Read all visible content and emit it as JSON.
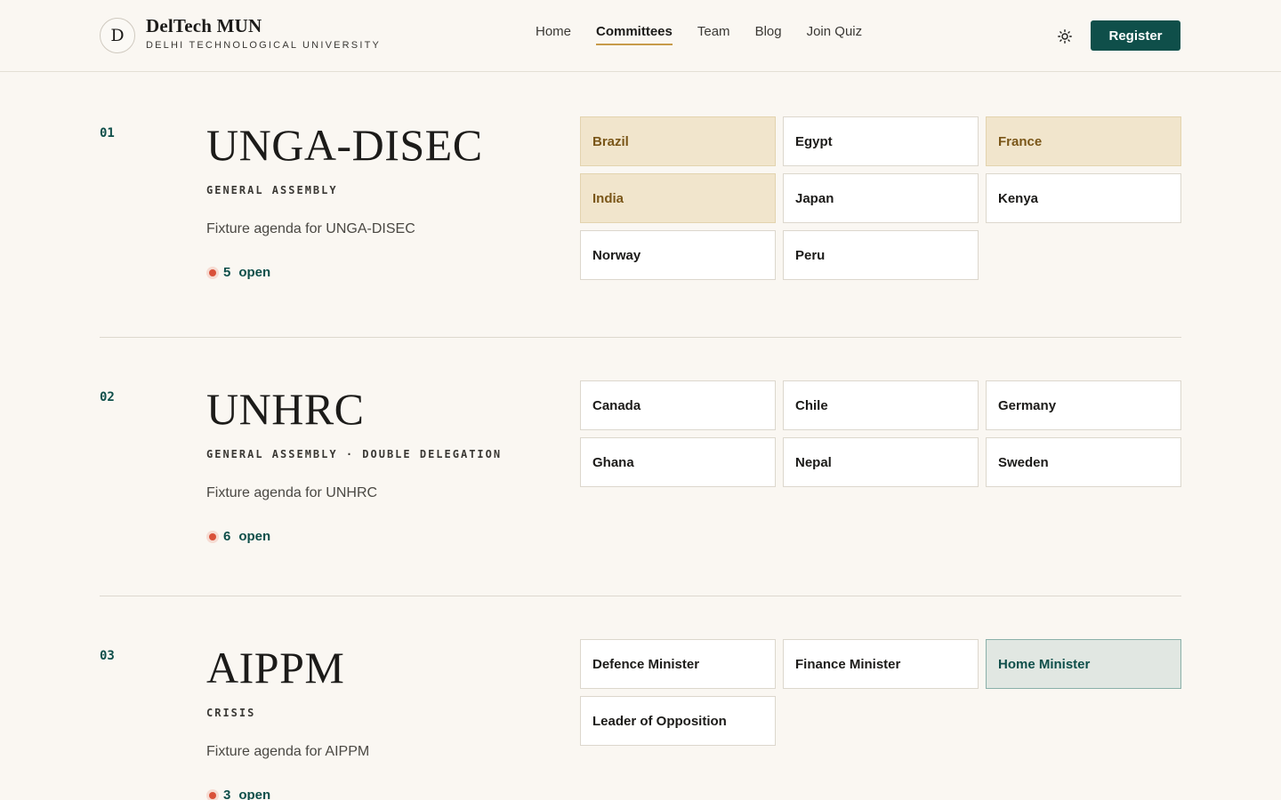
{
  "brand": {
    "logo_letter": "D",
    "title": "DelTech MUN",
    "subtitle": "DELHI TECHNOLOGICAL UNIVERSITY"
  },
  "nav": {
    "items": [
      {
        "label": "Home",
        "active": false
      },
      {
        "label": "Committees",
        "active": true
      },
      {
        "label": "Team",
        "active": false
      },
      {
        "label": "Blog",
        "active": false
      },
      {
        "label": "Join Quiz",
        "active": false
      }
    ],
    "theme_icon": "sun-icon",
    "register_label": "Register"
  },
  "colors": {
    "accent": "#0f4f4a",
    "taken": "#f1e5cc",
    "selected": "#e1e7e2",
    "open_dot": "#d9513a"
  },
  "committees": [
    {
      "number": "01",
      "name": "UNGA-DISEC",
      "type": "GENERAL ASSEMBLY",
      "agenda": "Fixture agenda for UNGA-DISEC",
      "open_count": "5",
      "open_label": "open",
      "portfolios": [
        {
          "label": "Brazil",
          "state": "taken"
        },
        {
          "label": "Egypt",
          "state": "available"
        },
        {
          "label": "France",
          "state": "taken"
        },
        {
          "label": "India",
          "state": "taken"
        },
        {
          "label": "Japan",
          "state": "available"
        },
        {
          "label": "Kenya",
          "state": "available"
        },
        {
          "label": "Norway",
          "state": "available"
        },
        {
          "label": "Peru",
          "state": "available"
        }
      ]
    },
    {
      "number": "02",
      "name": "UNHRC",
      "type": "GENERAL ASSEMBLY · DOUBLE DELEGATION",
      "agenda": "Fixture agenda for UNHRC",
      "open_count": "6",
      "open_label": "open",
      "portfolios": [
        {
          "label": "Canada",
          "state": "available"
        },
        {
          "label": "Chile",
          "state": "available"
        },
        {
          "label": "Germany",
          "state": "available"
        },
        {
          "label": "Ghana",
          "state": "available"
        },
        {
          "label": "Nepal",
          "state": "available"
        },
        {
          "label": "Sweden",
          "state": "available"
        }
      ]
    },
    {
      "number": "03",
      "name": "AIPPM",
      "type": "CRISIS",
      "agenda": "Fixture agenda for AIPPM",
      "open_count": "3",
      "open_label": "open",
      "portfolios": [
        {
          "label": "Defence Minister",
          "state": "available"
        },
        {
          "label": "Finance Minister",
          "state": "available"
        },
        {
          "label": "Home Minister",
          "state": "selected"
        },
        {
          "label": "Leader of Opposition",
          "state": "available"
        }
      ]
    }
  ]
}
